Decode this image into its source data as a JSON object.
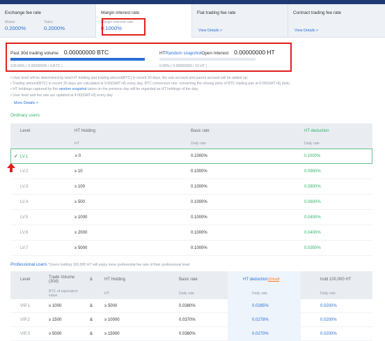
{
  "tabs": [
    {
      "title": "Exchange fee rate",
      "maker_label": "Maker",
      "maker_value": "0.2000%",
      "taker_label": "Taker",
      "taker_value": "0.2000%"
    },
    {
      "title": "Margin interest rate",
      "sub_label": "Margin interest rate",
      "value": "0.1000%"
    },
    {
      "title": "Fiat trading fee rate",
      "link": "View Details >"
    },
    {
      "title": "Contract trading fee rate",
      "link": "View Details >"
    }
  ],
  "volume": {
    "label": "Past 30d trading volume",
    "value": "0.00000000 BTC",
    "progress": 1.0,
    "progress_text": "100.00%  ( 0.00000000 / 0.BTC )"
  },
  "ht": {
    "prefix": "HT",
    "link": "Random snapshot",
    "label": "Open Interest",
    "value": "0.00000000 HT",
    "progress": 0.0,
    "progress_text": "0.00%  ( 0.00000000 / 10 HT )"
  },
  "notes": {
    "n1": "User level will be determined by total HT holding and trading amount(BTC) in recent 30 days, the sub-account and parent account will be added up;",
    "n2": "Trading amount(BTC) in recent 30 days are calculated at 0:00(GMT+8) every day. BTC conversion rule: converting the closing price of BTC trading pair at 0:00(GMT+8) daily;",
    "n3_a": "HT holdings captured by the ",
    "n3_link": "random snapshot",
    "n3_b": " taken on the previous day will be regarded as HT holdings of the day;",
    "n4": "User level and fee rate are updated at 4:00(GMT+8) every day",
    "more": "More Details >"
  },
  "ordinary": {
    "title": "Ordinary users",
    "headers": {
      "level": "Level",
      "ht": "HT Holding",
      "basic": "Basic rate",
      "ded": "HT deduction"
    },
    "subheaders": {
      "ht": "HT",
      "basic": "Daily rate",
      "ded": "Daily rate"
    },
    "rows": [
      {
        "level": "LV.1",
        "ht": "≥ 0",
        "basic": "0.1000%",
        "ded": "0.1000%"
      },
      {
        "level": "LV.2",
        "ht": "≥ 10",
        "basic": "0.1000%",
        "ded": "0.0900%"
      },
      {
        "level": "LV.3",
        "ht": "≥ 100",
        "basic": "0.1000%",
        "ded": "0.0800%"
      },
      {
        "level": "LV.4",
        "ht": "≥ 500",
        "basic": "0.1000%",
        "ded": "0.0600%"
      },
      {
        "level": "LV.5",
        "ht": "≥ 1000",
        "basic": "0.1000%",
        "ded": "0.0450%"
      },
      {
        "level": "LV.6",
        "ht": "≥ 2000",
        "basic": "0.1000%",
        "ded": "0.0400%"
      },
      {
        "level": "LV.7",
        "ht": "≥ 5000",
        "basic": "0.1000%",
        "ded": "0.0350%"
      }
    ]
  },
  "professional": {
    "title": "Professional users",
    "note": "*Users holding 100,000 HT will enjoy more preferential fee rate of their professional level",
    "headers": {
      "level": "Level",
      "tv": "Trade Volume (30d)",
      "and": "&",
      "ht": "HT Holding",
      "basic": "Basic rate",
      "ded": "HT deduction",
      "discount": "25%off",
      "hold": "hold 100,000 HT"
    },
    "subheaders": {
      "tv": "BTC of equivalent value",
      "ht": "HT",
      "basic": "Daily rate",
      "ded": "Daily rate",
      "hold": "Daily rate"
    },
    "rows": [
      {
        "level": "VIP.1",
        "tv": "≥ 1000",
        "and": "&",
        "ht": "≥ 5000",
        "basic": "0.0380%",
        "ded": "0.0285%",
        "hold": "0.0200%"
      },
      {
        "level": "VIP.2",
        "tv": "≥ 1500",
        "and": "&",
        "ht": "≥ 10000",
        "basic": "0.0370%",
        "ded": "0.0278%",
        "hold": "0.0200%"
      },
      {
        "level": "VIP.3",
        "tv": "≥ 5000",
        "and": "&",
        "ht": "≥ 15000",
        "basic": "0.0360%",
        "ded": "0.0270%",
        "hold": "0.0200%"
      }
    ]
  },
  "colors": {
    "accent_blue": "#2a6fd6",
    "green": "#2fb36b",
    "highlight_red": "#e02020",
    "header_navy": "#1f3a72"
  }
}
